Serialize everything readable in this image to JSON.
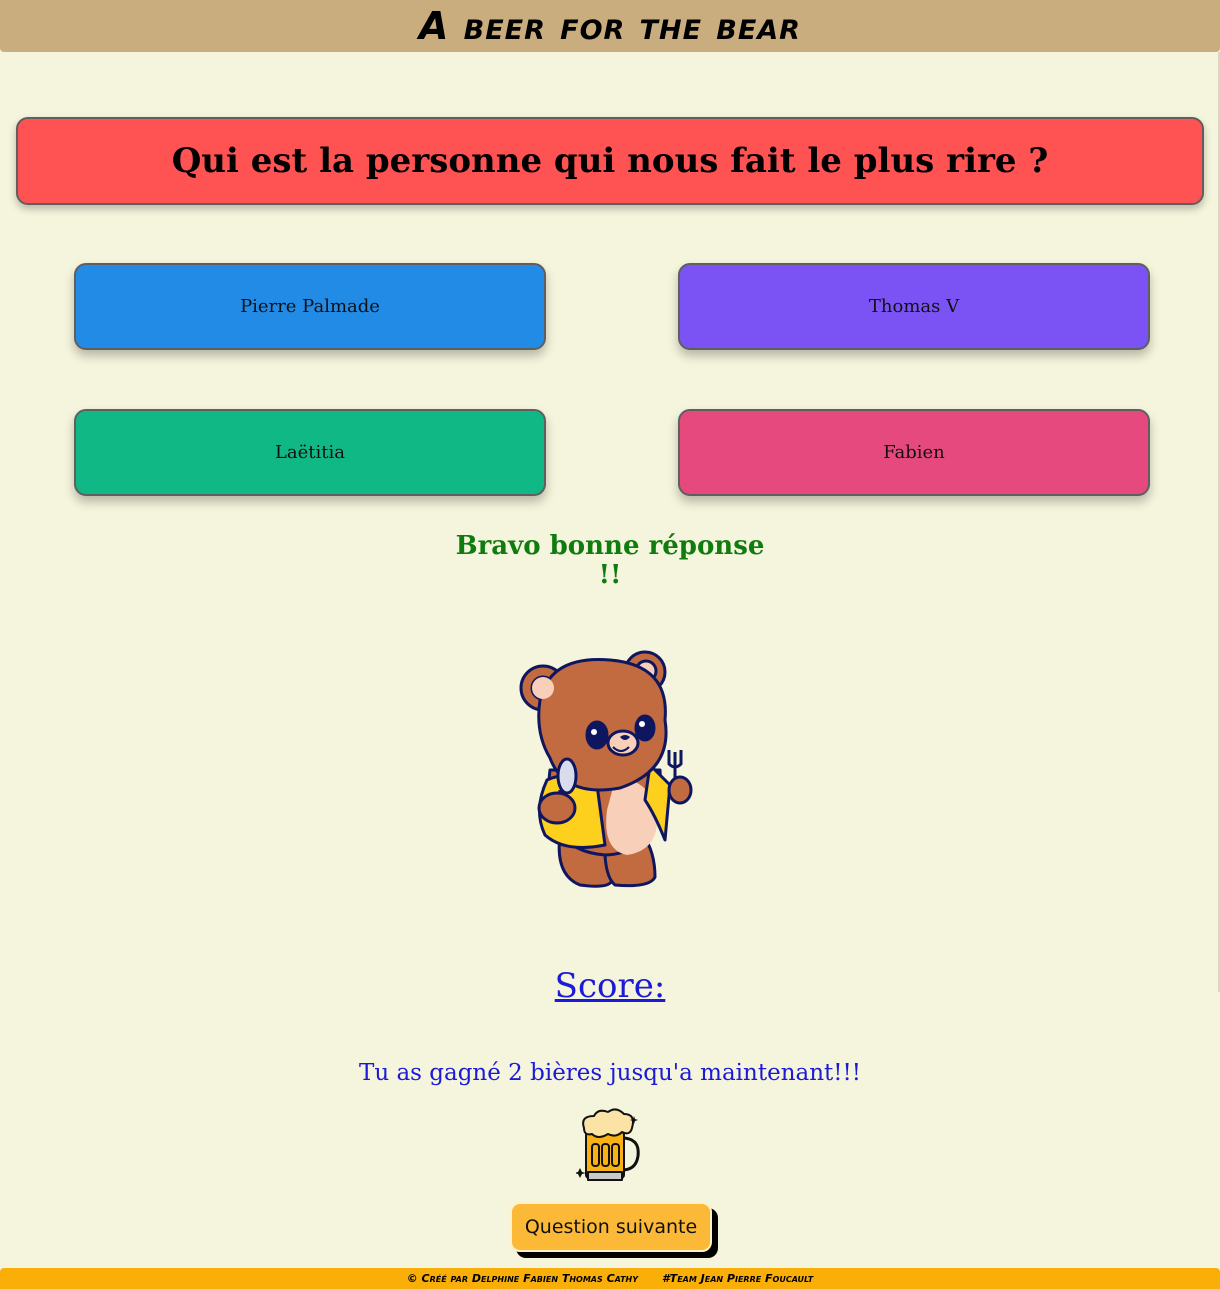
{
  "header": {
    "title": "A beer for the bear"
  },
  "question": {
    "text": "Qui est la personne qui nous fait le plus rire ?"
  },
  "answers": [
    {
      "label": "Pierre Palmade",
      "color": "#228be6"
    },
    {
      "label": "Thomas V",
      "color": "#7b53f4"
    },
    {
      "label": "Laëtitia",
      "color": "#10b885"
    },
    {
      "label": "Fabien",
      "color": "#e5497e"
    }
  ],
  "feedback": {
    "line1": "Bravo bonne réponse",
    "line2": "!!",
    "color": "#107c10"
  },
  "images": {
    "mascot": "bear-with-drumstick-and-fork",
    "reward": "beer-mug-icon"
  },
  "score": {
    "label": "Score:",
    "message": "Tu as gagné 2 bières jusqu'a maintenant!!!",
    "beers_won": 2
  },
  "next_button": {
    "label": "Question suivante",
    "color": "#fcb938"
  },
  "footer": {
    "credits": "© Créé par Delphine Fabien Thomas Cathy",
    "team": "#Team Jean Pierre Foucault"
  }
}
